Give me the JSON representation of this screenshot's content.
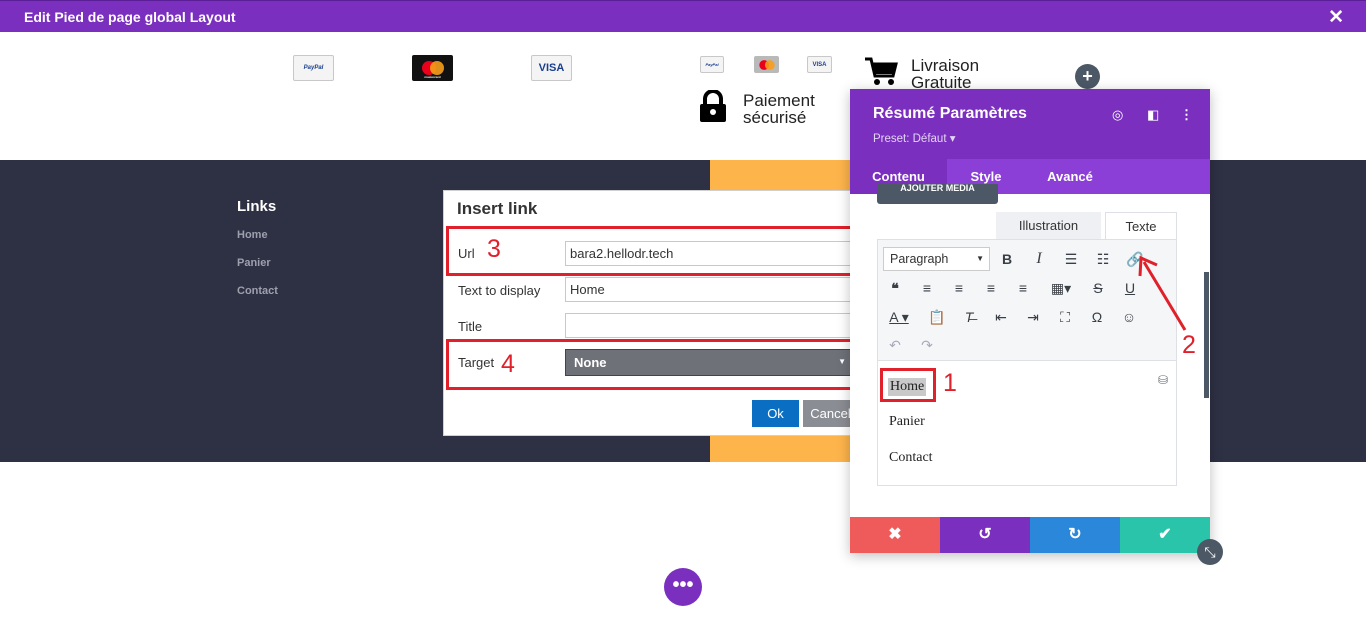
{
  "window": {
    "title": "Edit Pied de page global Layout"
  },
  "payments": {
    "large": [
      "PayPal",
      "mastercard",
      "VISA"
    ],
    "small": [
      "PayPal",
      "mastercard",
      "VISA"
    ]
  },
  "features": {
    "shipping": [
      "Livraison",
      "Gratuite"
    ],
    "secure": [
      "Paiement",
      "sécurisé"
    ]
  },
  "footer": {
    "links_heading": "Links",
    "links": [
      "Home",
      "Panier",
      "Contact"
    ]
  },
  "insert_link": {
    "title": "Insert link",
    "url_label": "Url",
    "url_value": "bara2.hellodr.tech",
    "display_label": "Text to display",
    "display_value": "Home",
    "title_label": "Title",
    "title_value": "",
    "target_label": "Target",
    "target_value": "None",
    "ok": "Ok",
    "cancel": "Cancel"
  },
  "annotations": [
    "1",
    "2",
    "3",
    "4"
  ],
  "annotation_color": "#e0202a",
  "panel": {
    "title": "Résumé Paramètres",
    "preset": "Preset: Défaut ▾",
    "tabs": [
      "Contenu",
      "Style",
      "Avancé"
    ],
    "active_tab": "Contenu",
    "media_button": "AJOUTER MÉDIA",
    "editor_tabs": [
      "Illustration",
      "Texte"
    ],
    "paragraph": "Paragraph",
    "content_items": [
      "Home",
      "Panier",
      "Contact"
    ]
  },
  "colors": {
    "brand_purple": "#7b2fbe",
    "dark_band": "#2e3044",
    "orange": "#fdb44b",
    "cancel_red": "#ef5a5a",
    "undo_purple": "#7b2fbe",
    "redo_blue": "#2b87da",
    "save_green": "#29c4a9"
  }
}
